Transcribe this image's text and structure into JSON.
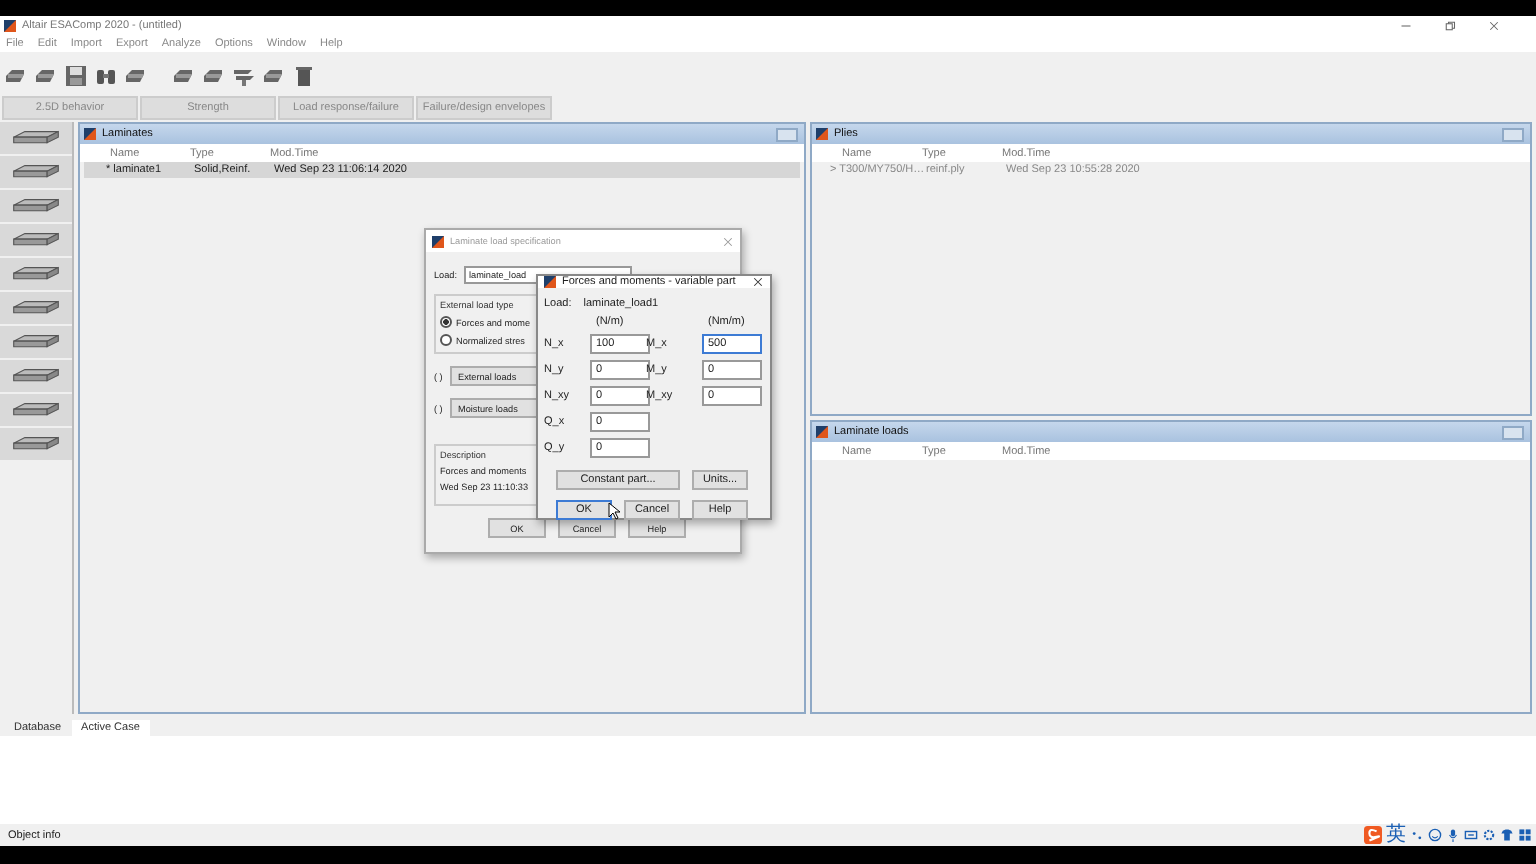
{
  "window": {
    "title": "Altair ESAComp 2020 - (untitled)"
  },
  "menu": [
    "File",
    "Edit",
    "Import",
    "Export",
    "Analyze",
    "Options",
    "Window",
    "Help"
  ],
  "tabs": [
    "2.5D behavior",
    "Strength",
    "Load response/failure",
    "Failure/design envelopes"
  ],
  "laminates_panel": {
    "title": "Laminates",
    "columns": [
      "Name",
      "Type",
      "Mod.Time"
    ],
    "rows": [
      {
        "marker": "*",
        "name": "laminate1",
        "type": "Solid,Reinf.",
        "mod_time": "Wed Sep 23 11:06:14 2020",
        "selected": true
      }
    ]
  },
  "plies_panel": {
    "title": "Plies",
    "columns": [
      "Name",
      "Type",
      "Mod.Time"
    ],
    "rows": [
      {
        "marker": ">",
        "name": "T300/MY750/H…",
        "type": "reinf.ply",
        "mod_time": "Wed Sep 23 10:55:28 2020",
        "selected": false
      }
    ]
  },
  "loads_panel": {
    "title": "Laminate loads",
    "columns": [
      "Name",
      "Type",
      "Mod.Time"
    ]
  },
  "load_dialog": {
    "title": "Laminate load specification",
    "load_label": "Load:",
    "load_value": "laminate_load",
    "group_title": "External load type",
    "options": [
      {
        "label": "Forces and mome",
        "selected": true
      },
      {
        "label": "Normalized stres",
        "selected": false
      }
    ],
    "load_buttons": [
      {
        "status": "( )",
        "label": "External loads"
      },
      {
        "status": "( )",
        "label": "Moisture loads"
      }
    ],
    "description_title": "Description",
    "description": [
      "Forces and moments",
      "Wed Sep 23 11:10:33"
    ],
    "buttons": [
      "OK",
      "Cancel",
      "Help"
    ]
  },
  "variable_dialog": {
    "title": "Forces and moments - variable part",
    "load_label": "Load:",
    "load_name": "laminate_load1",
    "units": [
      "(N/m)",
      "(Nm/m)"
    ],
    "rows": [
      [
        {
          "label": "N_x",
          "value": "100",
          "focused": false
        },
        {
          "label": "M_x",
          "value": "500",
          "focused": true
        }
      ],
      [
        {
          "label": "N_y",
          "value": "0",
          "focused": false
        },
        {
          "label": "M_y",
          "value": "0",
          "focused": false
        }
      ],
      [
        {
          "label": "N_xy",
          "value": "0",
          "focused": false
        },
        {
          "label": "M_xy",
          "value": "0",
          "focused": false
        }
      ],
      [
        {
          "label": "Q_x",
          "value": "0",
          "focused": false
        }
      ],
      [
        {
          "label": "Q_y",
          "value": "0",
          "focused": false
        }
      ]
    ],
    "extra_buttons": [
      "Constant part...",
      "Units..."
    ],
    "buttons": [
      {
        "label": "OK",
        "focused": true
      },
      {
        "label": "Cancel",
        "focused": false
      },
      {
        "label": "Help",
        "focused": false
      }
    ]
  },
  "bottom_tabs": [
    {
      "label": "Database",
      "selected": false
    },
    {
      "label": "Active Case",
      "selected": true
    }
  ],
  "status_bar": {
    "label": "Object info",
    "ime_mode": "英"
  }
}
